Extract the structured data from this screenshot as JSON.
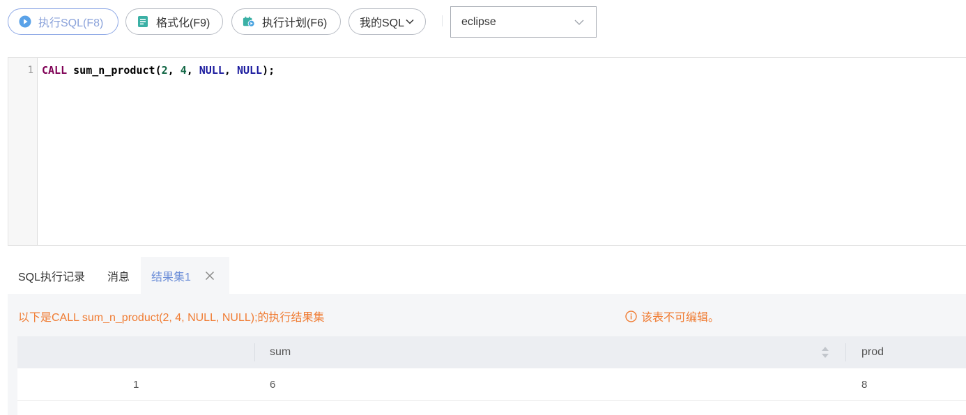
{
  "toolbar": {
    "run_label": "执行SQL(F8)",
    "format_label": "格式化(F9)",
    "plan_label": "执行计划(F6)",
    "my_sql_label": "我的SQL",
    "database_value": "eclipse",
    "accent_color": "#8fa9e6",
    "format_icon_color": "#3bb0a5",
    "plan_icon_color": "#3bb0a5"
  },
  "editor": {
    "line_numbers": [
      "1"
    ],
    "code": {
      "keyword": "CALL",
      "proc": "sum_n_product",
      "open": "(",
      "arg1": "2",
      "sep1": ", ",
      "arg2": "4",
      "sep2": ", ",
      "arg3": "NULL",
      "sep3": ", ",
      "arg4": "NULL",
      "close": ");"
    }
  },
  "result_tabs": [
    {
      "label": "SQL执行记录",
      "active": false
    },
    {
      "label": "消息",
      "active": false
    },
    {
      "label": "结果集1",
      "active": true
    }
  ],
  "result": {
    "title": "以下是CALL sum_n_product(2, 4, NULL, NULL);的执行结果集",
    "readonly_note": "该表不可编辑。",
    "note_color": "#f07c33",
    "columns": [
      "",
      "sum",
      "prod"
    ],
    "rows": [
      [
        "1",
        "6",
        "8"
      ]
    ]
  }
}
